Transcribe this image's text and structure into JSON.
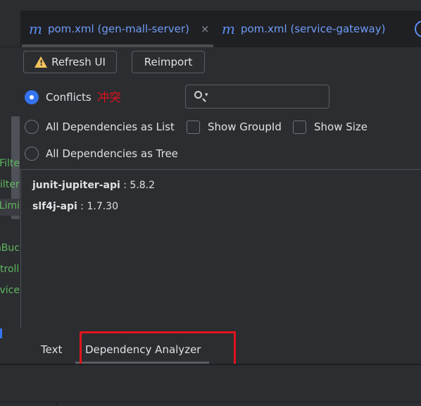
{
  "editor_tabs": [
    {
      "icon": "maven-m-icon",
      "label": "pom.xml (gen-mall-server)",
      "close": "×",
      "active": true
    },
    {
      "icon": "maven-m-icon",
      "label": "pom.xml (service-gateway)",
      "active": false
    }
  ],
  "project_tree_fragments": [
    "Filte",
    "ilter",
    "Limi",
    "nBuc",
    "troll",
    "rvice"
  ],
  "toolbar": {
    "refresh_label": "Refresh UI",
    "reimport_label": "Reimport"
  },
  "views": {
    "conflicts_label": "Conflicts",
    "conflicts_annotation": "冲突",
    "all_list_label": "All Dependencies as List",
    "all_tree_label": "All Dependencies as Tree",
    "selected": "conflicts"
  },
  "search": {
    "value": "",
    "placeholder": ""
  },
  "options": {
    "show_groupid_label": "Show GroupId",
    "show_groupid_checked": false,
    "show_size_label": "Show Size",
    "show_size_checked": false
  },
  "dependencies": [
    {
      "name": "junit-jupiter-api",
      "version": " : 5.8.2"
    },
    {
      "name": "slf4j-api",
      "version": " : 1.7.30"
    }
  ],
  "bottom_tabs": {
    "text_label": "Text",
    "analyzer_label": "Dependency Analyzer",
    "active": "analyzer"
  },
  "colors": {
    "accent": "#3574f0",
    "tab_text": "#6f9cf7",
    "annotation_red": "#e0141e",
    "tree_green": "#5fb85f",
    "warning": "#f2c55c"
  }
}
